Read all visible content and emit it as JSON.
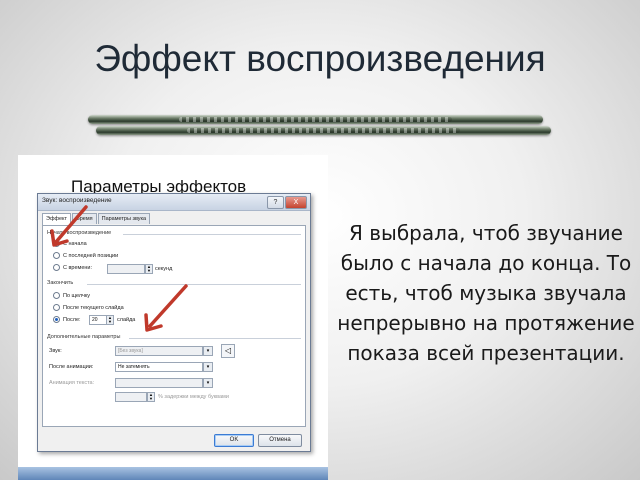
{
  "slide": {
    "title": "Эффект воспроизведения",
    "side_text": "Я выбрала, чтоб звучание было с начала  до  конца. То есть, чтоб музыка звучала непрерывно на протяжение показа всей презентации."
  },
  "screenshot": {
    "heading": "Параметры эффектов",
    "dialog": {
      "title": "Звук: воспроизведение",
      "titlebar_buttons": [
        "?",
        "X"
      ],
      "tabs": [
        {
          "label": "Эффект",
          "active": true
        },
        {
          "label": "Время",
          "active": false
        },
        {
          "label": "Параметры звука",
          "active": false
        }
      ],
      "start_group": {
        "label": "Начать воспроизведение",
        "options": [
          {
            "label": "С начала",
            "selected": true
          },
          {
            "label": "С последней позиции",
            "selected": false
          },
          {
            "label": "С времени:",
            "selected": false,
            "unit": "секунд"
          }
        ]
      },
      "end_group": {
        "label": "Закончить",
        "options": [
          {
            "label": "По щелчку",
            "selected": false
          },
          {
            "label": "После текущего слайда",
            "selected": false
          },
          {
            "label": "После:",
            "selected": true,
            "value": "20",
            "unit": "слайда"
          }
        ]
      },
      "extra_group": {
        "label": "Дополнительные параметры",
        "sound_label": "Звук:",
        "sound_value": "[Без звука]",
        "after_anim_label": "После анимации:",
        "after_anim_value": "Не затемнять",
        "text_anim_label": "Анимация текста:",
        "text_anim_value": "",
        "delay_text": "% задержки между буквами"
      },
      "ok_label": "OK",
      "cancel_label": "Отмена"
    }
  },
  "colors": {
    "title": "#1f2a36",
    "annotation_arrow": "#c0392b",
    "selection": "#1f5fbf"
  }
}
